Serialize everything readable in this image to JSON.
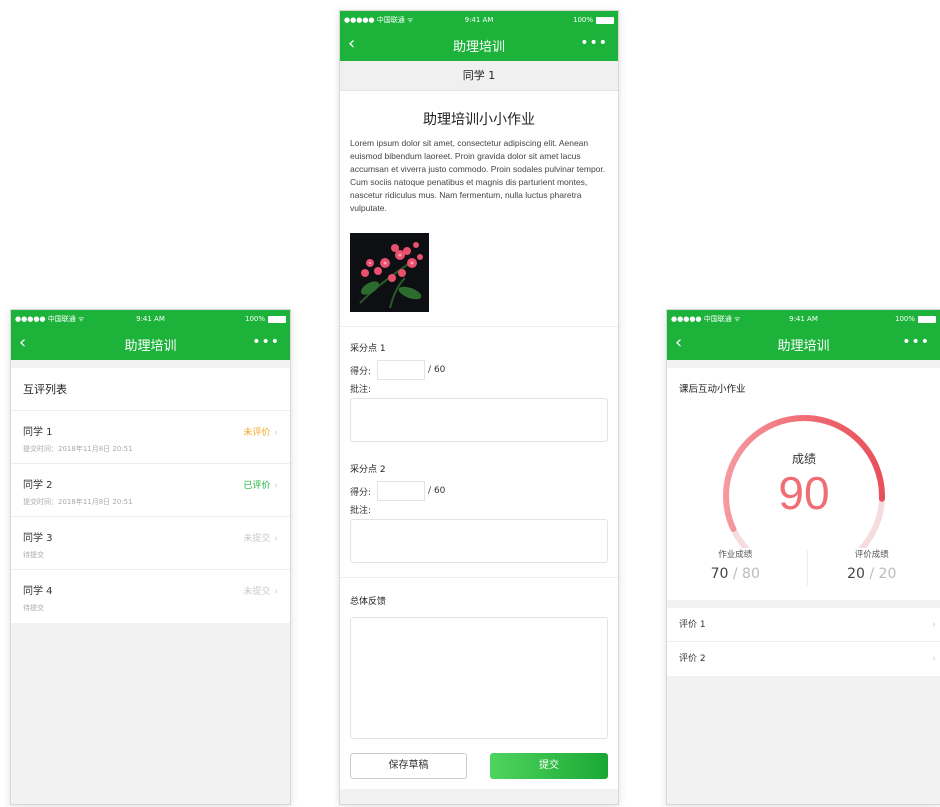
{
  "status_bar": {
    "carrier": "●●●●● 中国联通 ᯤ",
    "time": "9:41 AM",
    "battery": "100%"
  },
  "nav": {
    "back": "‹",
    "title": "助理培训",
    "more": "•••"
  },
  "peer_list": {
    "header": "互评列表",
    "rows": [
      {
        "name": "同学 1",
        "sub": "提交时间：2018年11月8日 20:51",
        "status": "未评价"
      },
      {
        "name": "同学 2",
        "sub": "提交时间：2018年11月8日 20:51",
        "status": "已评价"
      },
      {
        "name": "同学 3",
        "sub": "待提交",
        "status": "未提交"
      },
      {
        "name": "同学 4",
        "sub": "待提交",
        "status": "未提交"
      }
    ],
    "chevron": "›"
  },
  "review": {
    "student": "同学 1",
    "title": "助理培训小小作业",
    "body": "Lorem ipsum dolor sit amet, consectetur adipiscing elit. Aenean euismod bibendum laoreet. Proin gravida dolor sit amet lacus accumsan et viverra justo commodo. Proin sodales pulvinar tempor. Cum sociis natoque penatibus et magnis dis parturient montes, nascetur ridiculus mus. Nam fermentum, nulla luctus pharetra vulputate.",
    "points": [
      {
        "title": "采分点 1",
        "score_label": "得分:",
        "max": "/ 60",
        "note_label": "批注:"
      },
      {
        "title": "采分点 2",
        "score_label": "得分:",
        "max": "/ 60",
        "note_label": "批注:"
      }
    ],
    "feedback_label": "总体反馈",
    "draft_button": "保存草稿",
    "submit_button": "提交"
  },
  "result": {
    "heading": "课后互动小作业",
    "gauge_label": "成绩",
    "score": "90",
    "score_fraction": 0.9,
    "gauge_color": "#f06d74",
    "stats": [
      {
        "label": "作业成绩",
        "value": "70",
        "denom": " / 80"
      },
      {
        "label": "评价成绩",
        "value": "20",
        "denom": " / 20"
      }
    ],
    "evals": [
      "评价 1",
      "评价 2"
    ]
  },
  "colors": {
    "brand": "#1db33b",
    "pending": "#f5a623",
    "muted": "#c8c8c8"
  }
}
